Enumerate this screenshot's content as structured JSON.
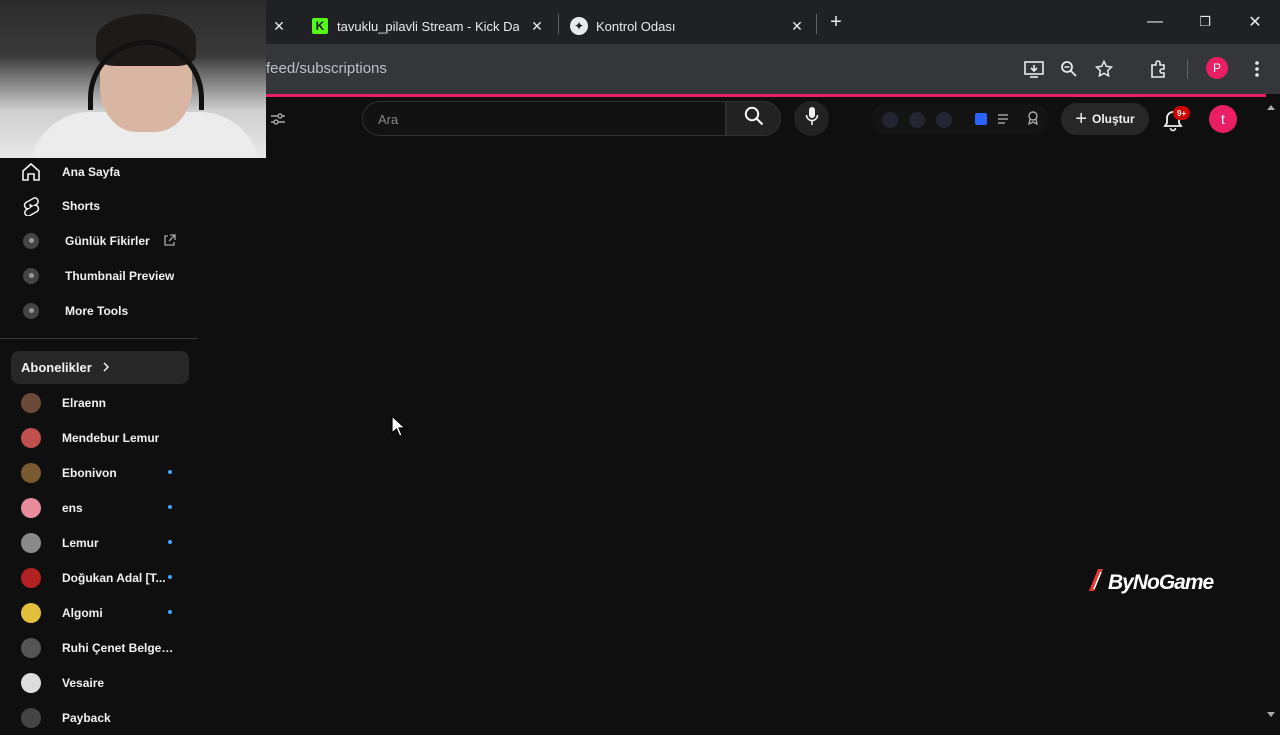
{
  "browser": {
    "tabs": [
      {
        "title": "tavuklu_pilavli Stream - Kick Da"
      },
      {
        "title": "Kontrol Odası"
      }
    ],
    "url": "feed/subscriptions",
    "profile_initial": "P"
  },
  "masthead": {
    "search_placeholder": "Ara",
    "create_label": "Oluştur",
    "notification_badge": "9+",
    "avatar_initial": "t"
  },
  "sidebar": {
    "main_items": [
      {
        "label": "Ana Sayfa",
        "icon": "home-icon"
      },
      {
        "label": "Shorts",
        "icon": "shorts-icon"
      },
      {
        "label": "Günlük Fikirler",
        "icon": "extension-icon"
      },
      {
        "label": "Thumbnail Preview",
        "icon": "extension-icon"
      },
      {
        "label": "More Tools",
        "icon": "extension-icon"
      }
    ],
    "subscriptions_header": "Abonelikler",
    "channels": [
      {
        "name": "Elraenn",
        "live": false,
        "color": "#6b4a3a"
      },
      {
        "name": "Mendebur Lemur",
        "live": false,
        "color": "#c0504d"
      },
      {
        "name": "Ebonivon",
        "live": true,
        "color": "#7a5a30"
      },
      {
        "name": "ens",
        "live": true,
        "color": "#e88b9a"
      },
      {
        "name": "Lemur",
        "live": true,
        "color": "#8a8a8a"
      },
      {
        "name": "Doğukan Adal [T...",
        "live": true,
        "color": "#b22222"
      },
      {
        "name": "Algomi",
        "live": true,
        "color": "#e2c03c"
      },
      {
        "name": "Ruhi Çenet Belgese...",
        "live": false,
        "color": "#555555"
      },
      {
        "name": "Vesaire",
        "live": false,
        "color": "#dddddd"
      },
      {
        "name": "Payback",
        "live": false,
        "color": "#444444"
      }
    ]
  },
  "watermark": "ByNoGame"
}
